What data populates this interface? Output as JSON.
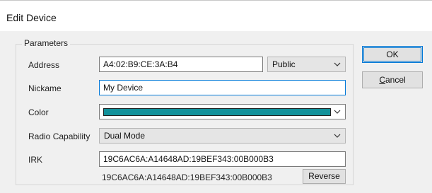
{
  "window": {
    "title": "Edit Device"
  },
  "group": {
    "label": "Parameters"
  },
  "fields": {
    "address": {
      "label": "Address",
      "value": "A4:02:B9:CE:3A:B4",
      "type_value": "Public"
    },
    "nickname": {
      "label": "Nickame",
      "value": "My Device"
    },
    "color": {
      "label": "Color",
      "swatch_color": "#12919a"
    },
    "radio_capability": {
      "label": "Radio Capability",
      "value": "Dual Mode"
    },
    "irk": {
      "label": "IRK",
      "value": "19C6AC6A:A14648AD:19BEF343:00B000B3",
      "display": "19C6AC6A:A14648AD:19BEF343:00B000B3",
      "reverse_label": "Reverse"
    }
  },
  "buttons": {
    "ok_label": "OK",
    "cancel_label": "Cancel"
  },
  "icons": {
    "dropdown": "chevron-down-icon"
  }
}
